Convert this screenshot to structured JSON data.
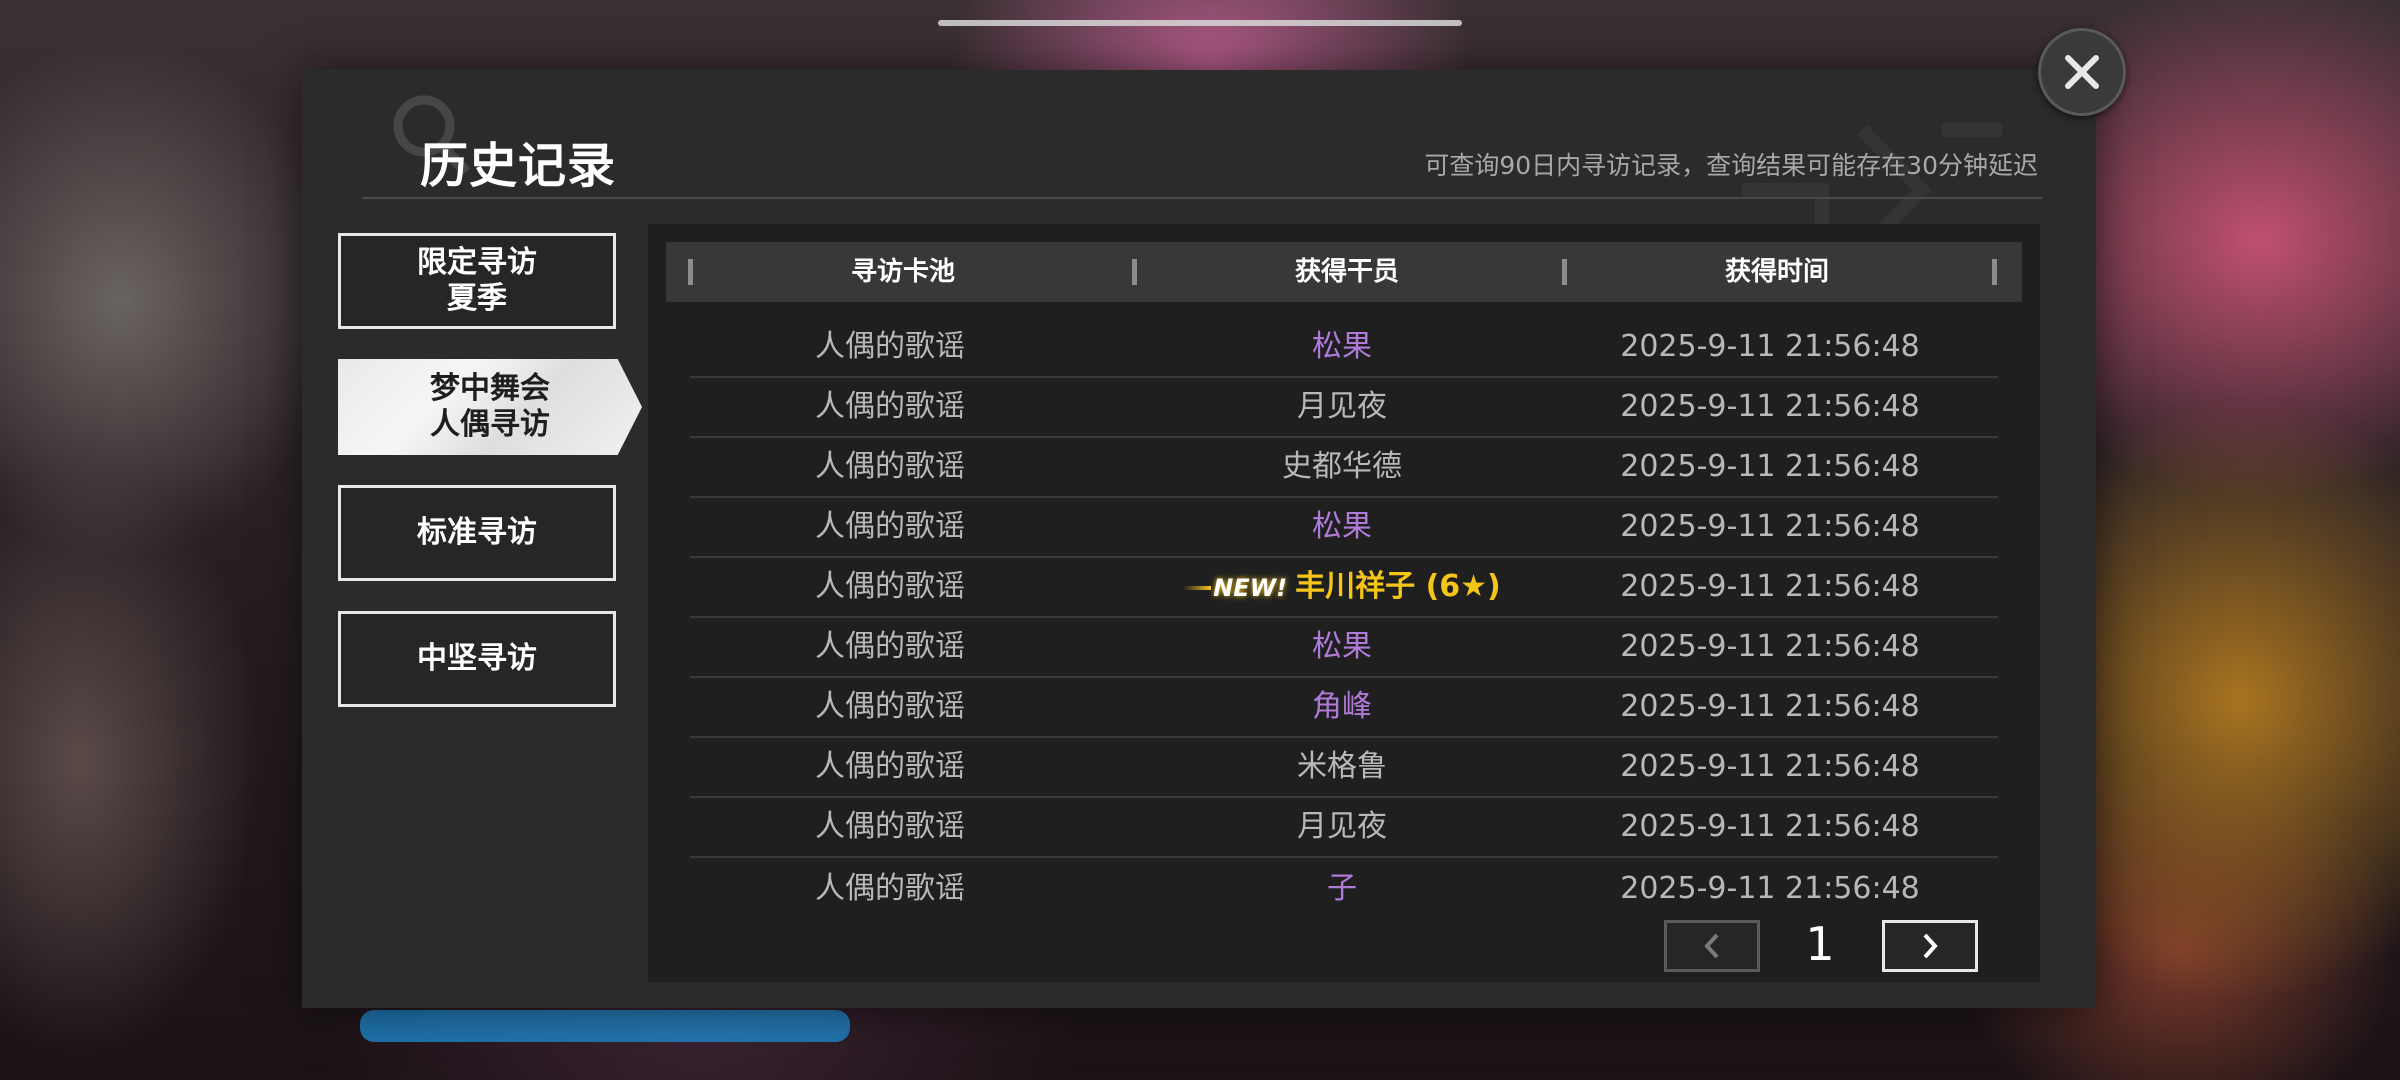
{
  "dialog": {
    "title": "历史记录",
    "subtitle": "可查询90日内寻访记录，查询结果可能存在30分钟延迟",
    "close_icon": "close-icon"
  },
  "sidebar": {
    "items": [
      {
        "lines": [
          "限定寻访",
          "夏季"
        ],
        "active": false
      },
      {
        "lines": [
          "梦中舞会",
          "人偶寻访"
        ],
        "active": true
      },
      {
        "lines": [
          "标准寻访"
        ],
        "active": false
      },
      {
        "lines": [
          "中坚寻访"
        ],
        "active": false
      }
    ]
  },
  "table": {
    "headers": [
      "寻访卡池",
      "获得干员",
      "获得时间"
    ],
    "rows": [
      {
        "pool": "人偶的歌谣",
        "operator": "松果",
        "time": "2025-9-11 21:56:48",
        "rarity": "purple"
      },
      {
        "pool": "人偶的歌谣",
        "operator": "月见夜",
        "time": "2025-9-11 21:56:48",
        "rarity": "normal"
      },
      {
        "pool": "人偶的歌谣",
        "operator": "史都华德",
        "time": "2025-9-11 21:56:48",
        "rarity": "normal"
      },
      {
        "pool": "人偶的歌谣",
        "operator": "松果",
        "time": "2025-9-11 21:56:48",
        "rarity": "purple"
      },
      {
        "pool": "人偶的歌谣",
        "operator": "丰川祥子 (6★)",
        "time": "2025-9-11 21:56:48",
        "rarity": "gold",
        "new": "NEW!"
      },
      {
        "pool": "人偶的歌谣",
        "operator": "松果",
        "time": "2025-9-11 21:56:48",
        "rarity": "purple"
      },
      {
        "pool": "人偶的歌谣",
        "operator": "角峰",
        "time": "2025-9-11 21:56:48",
        "rarity": "purple"
      },
      {
        "pool": "人偶的歌谣",
        "operator": "米格鲁",
        "time": "2025-9-11 21:56:48",
        "rarity": "normal"
      },
      {
        "pool": "人偶的歌谣",
        "operator": "月见夜",
        "time": "2025-9-11 21:56:48",
        "rarity": "normal"
      },
      {
        "pool": "人偶的歌谣",
        "operator": "子",
        "time": "2025-9-11 21:56:48",
        "rarity": "purple"
      }
    ]
  },
  "pagination": {
    "current_page": "1",
    "prev_icon": "chevron-left-icon",
    "next_icon": "chevron-right-icon"
  },
  "colors": {
    "purple": "#b07ad8",
    "gold": "#f5c518",
    "panel": "#2b2b2b",
    "table_bg": "#1f1f1f"
  }
}
